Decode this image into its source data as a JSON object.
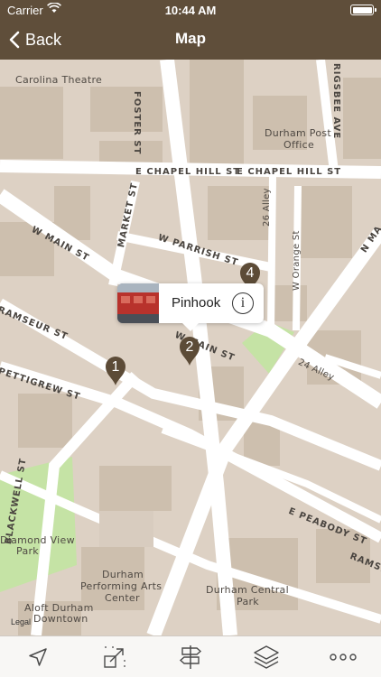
{
  "status_bar": {
    "carrier": "Carrier",
    "time": "10:44 AM"
  },
  "nav": {
    "back_label": "Back",
    "title": "Map"
  },
  "map": {
    "labels": {
      "carolina_theatre": "Carolina Theatre",
      "foster_st": "FOSTER ST",
      "rigsbee_ave": "RIGSBEE AVE",
      "durham_post_office_1": "Durham Post",
      "durham_post_office_2": "Office",
      "e_chapel_hill_st_1": "E CHAPEL HILL ST",
      "e_chapel_hill_st_2": "E CHAPEL HILL ST",
      "market_st": "MARKET ST",
      "alley_26": "26 Alley",
      "w_main_st_1": "W MAIN ST",
      "w_parrish_st": "W PARRISH ST",
      "w_orange_st": "W Orange St",
      "n_ma": "N MA",
      "ramseur_st_1": "RAMSEUR ST",
      "w_main_st_2": "W MAIN ST",
      "alley_24": "24 Alley",
      "pettigrew_st": "PETTIGREW ST",
      "blackwell_st": "BLACKWELL ST",
      "e_peabody_st": "E PEABODY ST",
      "ramseur_st_2": "RAMSE",
      "diamond_view_park_1": "Diamond View",
      "diamond_view_park_2": "Park",
      "dpac_1": "Durham",
      "dpac_2": "Performing Arts",
      "dpac_3": "Center",
      "durham_central_park_1": "Durham Central",
      "durham_central_park_2": "Park",
      "aloft_1": "Aloft Durham",
      "aloft_2": "Downtown",
      "legal": "Legal"
    },
    "pins": [
      {
        "number": "1"
      },
      {
        "number": "2"
      },
      {
        "number": "4"
      }
    ],
    "callout": {
      "name": "Pinhook",
      "info_glyph": "i"
    },
    "colors": {
      "pin": "#5c4b37",
      "park": "#c5e3a5",
      "block": "#dcd0c3",
      "building": "#cdbfae"
    }
  },
  "toolbar": {
    "items": [
      {
        "icon": "location-arrow-icon"
      },
      {
        "icon": "resize-icon"
      },
      {
        "icon": "signpost-icon"
      },
      {
        "icon": "layers-icon"
      },
      {
        "icon": "more-icon"
      }
    ]
  }
}
